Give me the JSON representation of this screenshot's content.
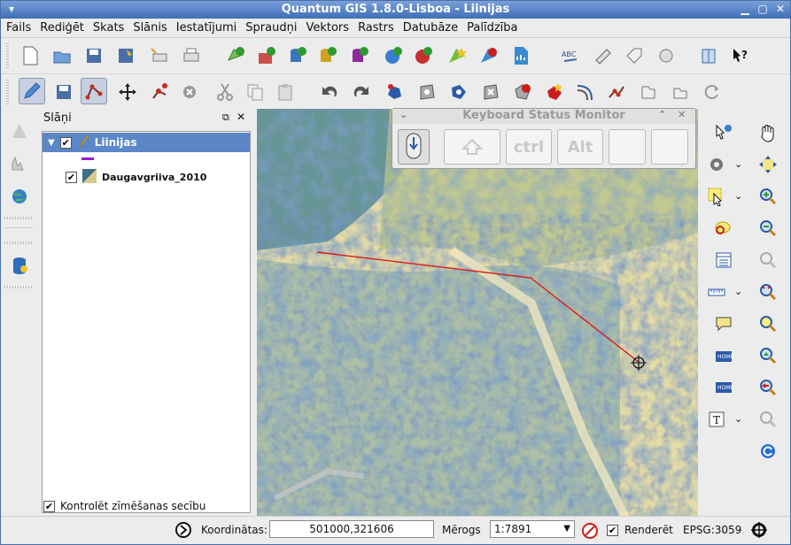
{
  "window": {
    "title": "Quantum GIS 1.8.0-Lisboa - Liinijas"
  },
  "menu": [
    "Fails",
    "Rediģēt",
    "Skats",
    "Slānis",
    "Iestatījumi",
    "Spraudņi",
    "Vektors",
    "Rastrs",
    "Datubāze",
    "Palīdzība"
  ],
  "layers_panel": {
    "title": "Slāņi",
    "layers": [
      {
        "name": "Liinijas",
        "checked": "✔",
        "selected": true
      },
      {
        "name": "Daugavgriiva_2010",
        "checked": "✔",
        "selected": false
      }
    ],
    "render_order_checkbox": "✔",
    "render_order_label": "Kontrolēt zīmēšanas secību"
  },
  "keyboard_monitor": {
    "title": "Keyboard Status Monitor",
    "keys": [
      "",
      "ctrl",
      "Alt",
      "",
      ""
    ]
  },
  "statusbar": {
    "coords_label": "Koordinātas:",
    "coords_value": "501000,321606",
    "scale_label": "Mērogs",
    "scale_value": "1:7891",
    "render_checkbox": "✔",
    "render_label": "Renderēt",
    "crs": "EPSG:3059"
  },
  "colors": {
    "title_bar": "#3f6eb8",
    "selected_layer": "#5b86c8",
    "line_feature": "#e01818",
    "layer_symbol": "#9b19d6"
  }
}
